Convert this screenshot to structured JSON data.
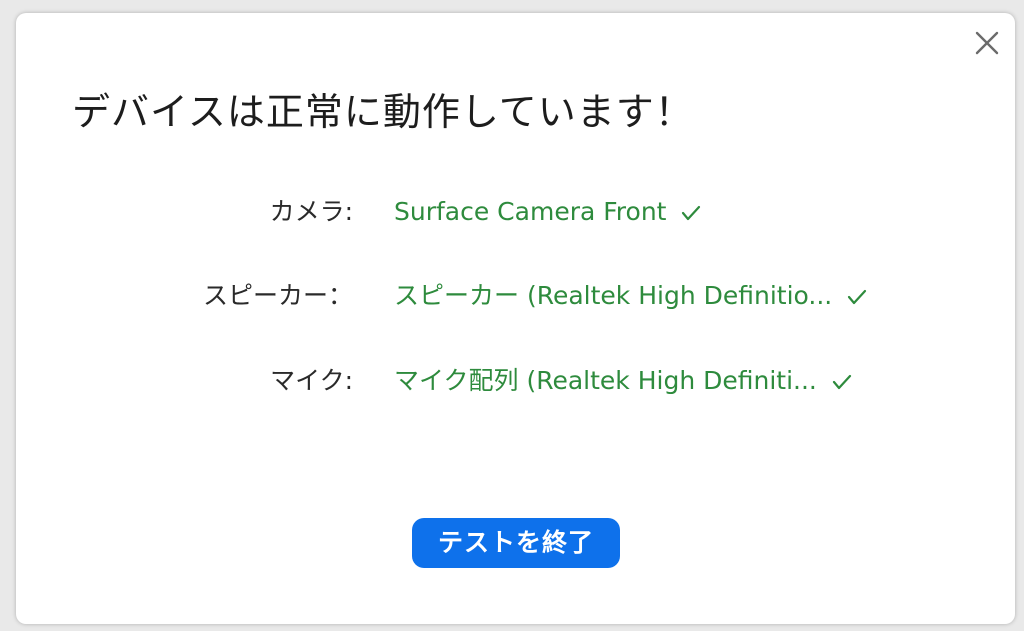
{
  "dialog": {
    "title": "デバイスは正常に動作しています！",
    "close_icon": "close-icon"
  },
  "devices": {
    "camera": {
      "label": "カメラ:",
      "value": "Surface Camera Front",
      "status_icon": "checkmark-icon"
    },
    "speaker": {
      "label": "スピーカー：",
      "value": "スピーカー (Realtek High Definitio...",
      "status_icon": "checkmark-icon"
    },
    "microphone": {
      "label": "マイク:",
      "value": "マイク配列 (Realtek High Definiti...",
      "status_icon": "checkmark-icon"
    }
  },
  "actions": {
    "end_test_label": "テストを終了"
  },
  "colors": {
    "accent": "#0e71eb",
    "success": "#2e8b3d",
    "text": "#1d1d1d",
    "background": "#ffffff"
  }
}
